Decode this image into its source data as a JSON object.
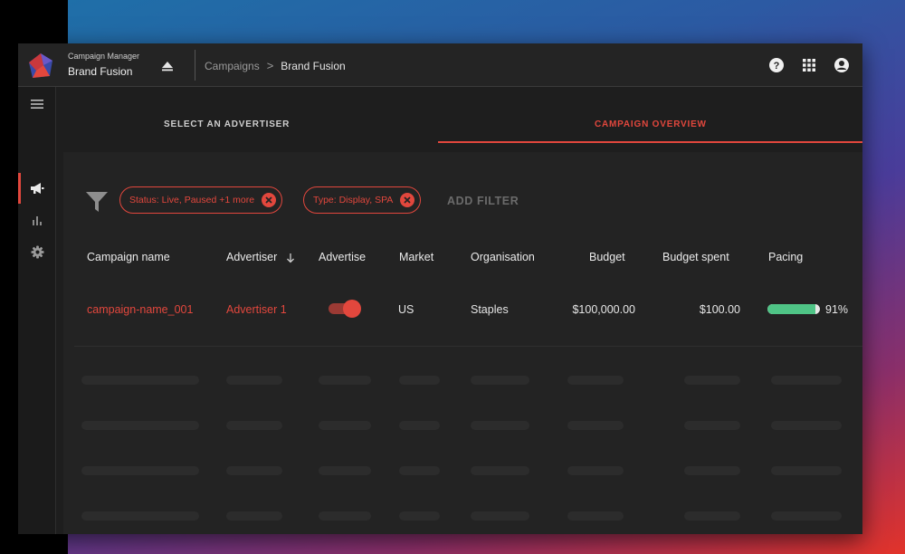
{
  "app": {
    "product_name": "Campaign Manager",
    "account_name": "Brand Fusion"
  },
  "breadcrumb": {
    "items": [
      "Campaigns",
      "Brand Fusion"
    ],
    "separator": ">"
  },
  "tabs": [
    {
      "label": "SELECT AN ADVERTISER",
      "active": false
    },
    {
      "label": "CAMPAIGN OVERVIEW",
      "active": true
    }
  ],
  "filters": {
    "chips": [
      {
        "label": "Status: Live, Paused +1 more"
      },
      {
        "label": "Type: Display, SPA"
      }
    ],
    "add_filter_label": "ADD FILTER"
  },
  "table": {
    "columns": [
      "Campaign name",
      "Advertiser",
      "Advertise",
      "Market",
      "Organisation",
      "Budget",
      "Budget spent",
      "Pacing"
    ],
    "sorted_column": "Advertiser",
    "rows": [
      {
        "campaign_name": "campaign-name_001",
        "advertiser": "Advertiser 1",
        "advertise_on": true,
        "market": "US",
        "organisation": "Staples",
        "budget": "$100,000.00",
        "budget_spent": "$100.00",
        "pacing_percent": 91,
        "pacing_label": "91%"
      }
    ]
  },
  "icons": {
    "sidebar": [
      "menu-icon",
      "megaphone-icon",
      "bar-chart-icon",
      "settings-icon"
    ],
    "topbar": [
      "help-icon",
      "apps-grid-icon",
      "account-icon"
    ]
  },
  "colors": {
    "accent": "#e2473d",
    "pacing_fill": "#4fc486",
    "background": "#1e1e1e"
  }
}
